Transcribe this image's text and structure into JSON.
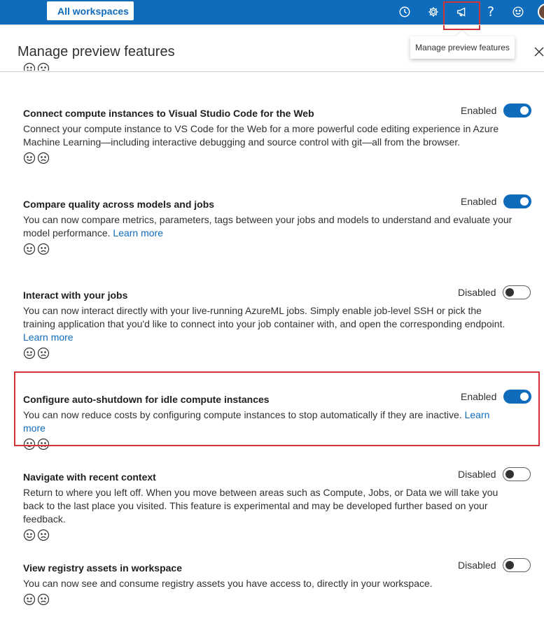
{
  "topbar": {
    "workspace_button": "All workspaces",
    "icons": [
      "history-icon",
      "gear-icon",
      "megaphone-icon",
      "help-icon",
      "smiley-icon",
      "avatar"
    ],
    "help_glyph": "?"
  },
  "tooltip": "Manage preview features",
  "panel": {
    "title": "Manage preview features"
  },
  "features": [
    {
      "title": "Connect compute instances to Visual Studio Code for the Web",
      "description": "Connect your compute instance to VS Code for the Web for a more powerful code editing experience in Azure Machine Learning—including interactive debugging and source control with git—all from the browser.",
      "link": "",
      "status": "Enabled",
      "enabled": true
    },
    {
      "title": "Compare quality across models and jobs",
      "description": "You can now compare metrics, parameters, tags between your jobs and models to understand and evaluate your model performance.",
      "link": "Learn more",
      "status": "Enabled",
      "enabled": true
    },
    {
      "title": "Interact with your jobs",
      "description": "You can now interact directly with your live-running AzureML jobs. Simply enable job-level SSH or pick the training application that you'd like to connect into your job container with, and open the corresponding endpoint.",
      "link": "Learn more",
      "status": "Disabled",
      "enabled": false
    },
    {
      "title": "Configure auto-shutdown for idle compute instances",
      "description": "You can now reduce costs by configuring compute instances to stop automatically if they are inactive.",
      "link": "Learn more",
      "status": "Enabled",
      "enabled": true
    },
    {
      "title": "Navigate with recent context",
      "description": "Return to where you left off. When you move between areas such as Compute, Jobs, or Data we will take you back to the last place you visited. This feature is experimental and may be developed further based on your feedback.",
      "link": "",
      "status": "Disabled",
      "enabled": false
    },
    {
      "title": "View registry assets in workspace",
      "description": "You can now see and consume registry assets you have access to, directly in your workspace.",
      "link": "",
      "status": "Disabled",
      "enabled": false
    }
  ],
  "colors": {
    "accent": "#0f6cbd",
    "highlight": "#d13438"
  }
}
